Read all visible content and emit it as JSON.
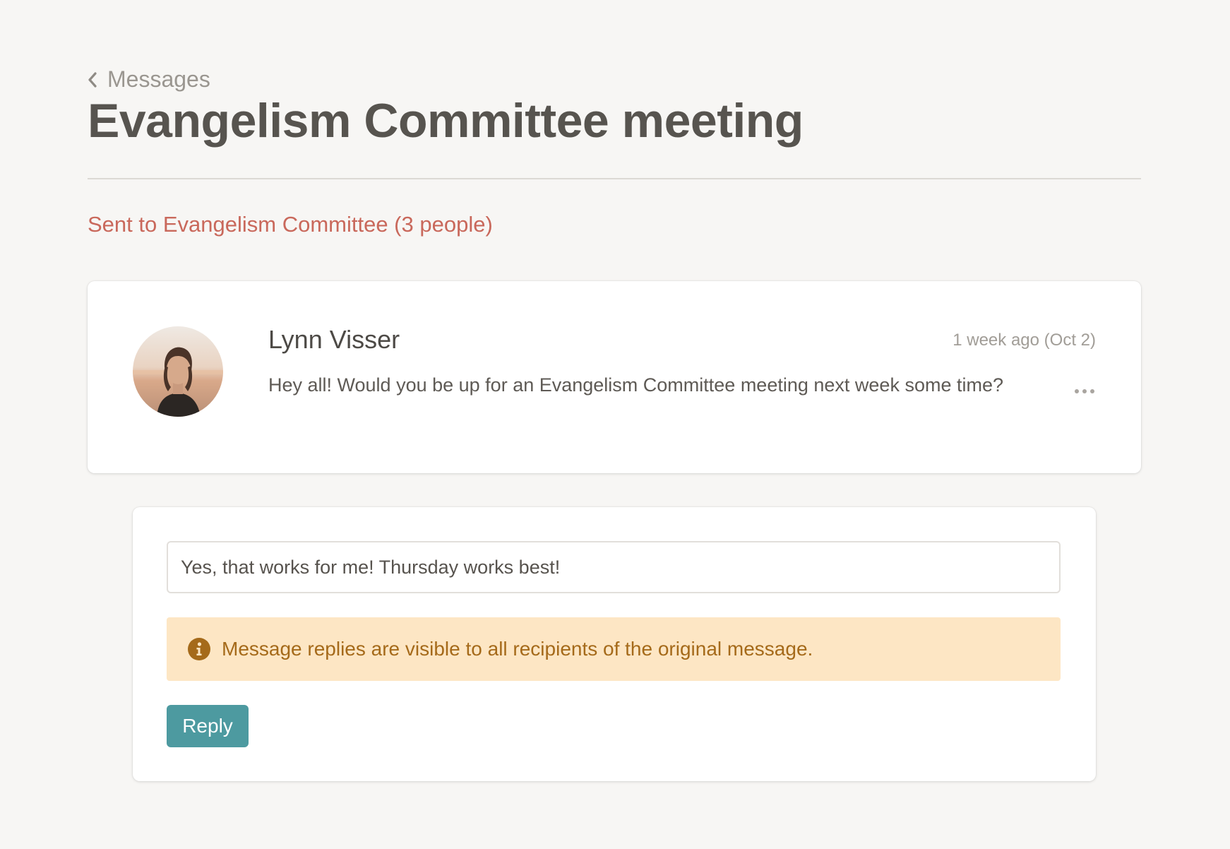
{
  "header": {
    "back_label": "Messages",
    "title": "Evangelism Committee meeting"
  },
  "recipients": {
    "label": "Sent to Evangelism Committee (3 people)"
  },
  "message": {
    "sender": "Lynn Visser",
    "timestamp": "1 week ago (Oct 2)",
    "body": "Hey all! Would you be up for an Evangelism Committee meeting next week some time?",
    "avatar_icon": "avatar-photo",
    "more_icon": "more-horizontal-icon"
  },
  "reply": {
    "input_value": "Yes, that works for me! Thursday works best!",
    "notice_text": "Message replies are visible to all recipients of the original message.",
    "notice_icon": "info-icon",
    "button_label": "Reply"
  },
  "colors": {
    "background": "#f7f6f4",
    "title": "#57544f",
    "accent_link": "#c9685b",
    "notice_bg": "#fde6c4",
    "notice_text": "#a56a1a",
    "button": "#4d9aa0"
  }
}
